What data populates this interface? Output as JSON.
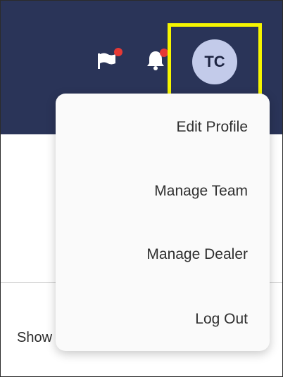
{
  "header": {
    "background": "#2a3458",
    "icons": [
      {
        "name": "flag-icon",
        "has_notification": true
      },
      {
        "name": "bell-icon",
        "has_notification": true
      }
    ],
    "notification_color": "#e53935",
    "avatar": {
      "initials": "TC",
      "background": "#c3cbea"
    },
    "highlight_color": "#f5f500"
  },
  "page": {
    "show_text": "Show"
  },
  "dropdown": {
    "items": [
      {
        "label": "Edit Profile"
      },
      {
        "label": "Manage Team"
      },
      {
        "label": "Manage Dealer"
      },
      {
        "label": "Log Out"
      }
    ]
  }
}
